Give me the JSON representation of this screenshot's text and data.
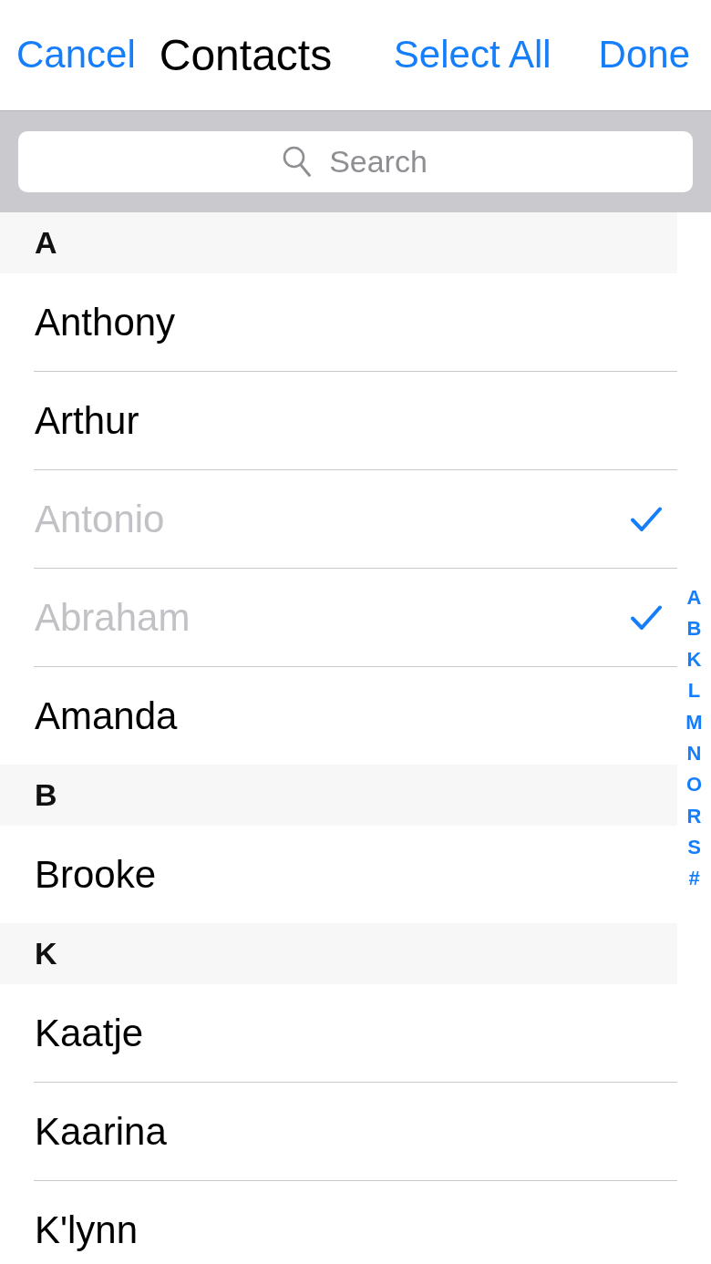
{
  "nav": {
    "cancel": "Cancel",
    "title": "Contacts",
    "select_all": "Select All",
    "done": "Done"
  },
  "search": {
    "placeholder": "Search"
  },
  "sections": [
    {
      "letter": "A",
      "contacts": [
        {
          "name": "Anthony",
          "selected": false
        },
        {
          "name": "Arthur",
          "selected": false
        },
        {
          "name": "Antonio",
          "selected": true
        },
        {
          "name": "Abraham",
          "selected": true
        },
        {
          "name": "Amanda",
          "selected": false
        }
      ]
    },
    {
      "letter": "B",
      "contacts": [
        {
          "name": "Brooke",
          "selected": false
        }
      ]
    },
    {
      "letter": "K",
      "contacts": [
        {
          "name": "Kaatje",
          "selected": false
        },
        {
          "name": "Kaarina",
          "selected": false
        },
        {
          "name": "K'lynn",
          "selected": false
        }
      ]
    }
  ],
  "index": [
    "A",
    "B",
    "K",
    "L",
    "M",
    "N",
    "O",
    "R",
    "S",
    "#"
  ]
}
